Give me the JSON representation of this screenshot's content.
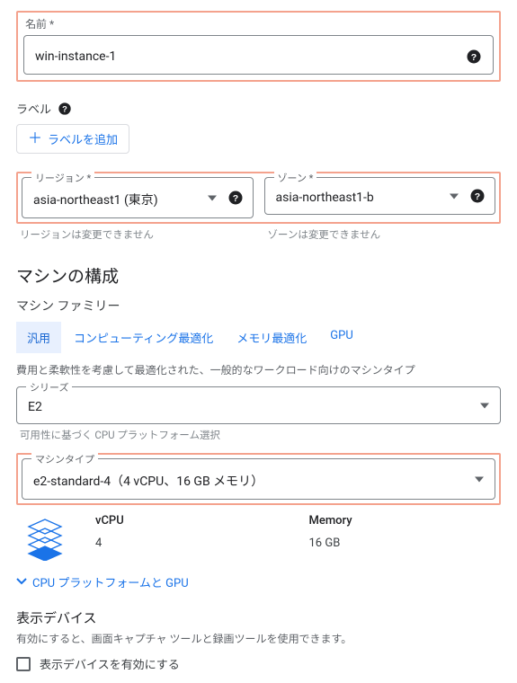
{
  "name_section": {
    "label": "名前 *",
    "value": "win-instance-1"
  },
  "labels_section": {
    "label": "ラベル",
    "add_button": "ラベルを追加"
  },
  "region_section": {
    "region_label": "リージョン *",
    "region_value": "asia-northeast1 (東京)",
    "region_hint": "リージョンは変更できません",
    "zone_label": "ゾーン *",
    "zone_value": "asia-northeast1-b",
    "zone_hint": "ゾーンは変更できません"
  },
  "machine_config": {
    "title": "マシンの構成",
    "family_label": "マシン ファミリー",
    "tabs": {
      "general": "汎用",
      "compute": "コンピューティング最適化",
      "memory": "メモリ最適化",
      "gpu": "GPU"
    },
    "description": "費用と柔軟性を考慮して最適化された、一般的なワークロード向けのマシンタイプ",
    "series_label": "シリーズ",
    "series_value": "E2",
    "series_hint": "可用性に基づく CPU プラットフォーム選択",
    "machine_type_label": "マシンタイプ",
    "machine_type_value": "e2-standard-4（4 vCPU、16 GB メモリ）",
    "specs": {
      "vcpu_label": "vCPU",
      "vcpu_value": "4",
      "memory_label": "Memory",
      "memory_value": "16 GB"
    },
    "expand_link": "CPU プラットフォームと GPU"
  },
  "display_device": {
    "title": "表示デバイス",
    "description": "有効にすると、画面キャプチャ ツールと録画ツールを使用できます。",
    "checkbox_label": "表示デバイスを有効にする"
  }
}
